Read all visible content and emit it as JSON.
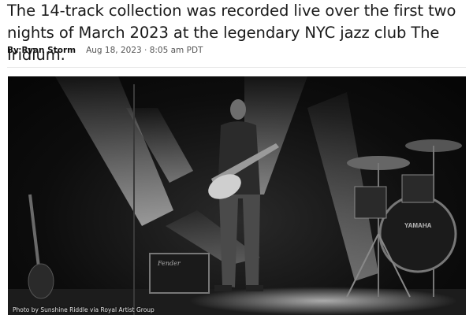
{
  "article": {
    "dek": "The 14-track collection was recorded live over the first two nights of March 2023 at the legendary NYC jazz club The Iridium.",
    "author": "By Ryan Storm",
    "date": "Aug 18, 2023 · 8:05 am PDT"
  },
  "photo": {
    "credit": "Photo by Sunshine Riddle via Royal Artist Group",
    "drum_brand": "YAMAHA",
    "amp_brand": "Fender"
  },
  "colors": {
    "text": "#1a1a1a",
    "photo_bg": "#0d0d0d"
  }
}
